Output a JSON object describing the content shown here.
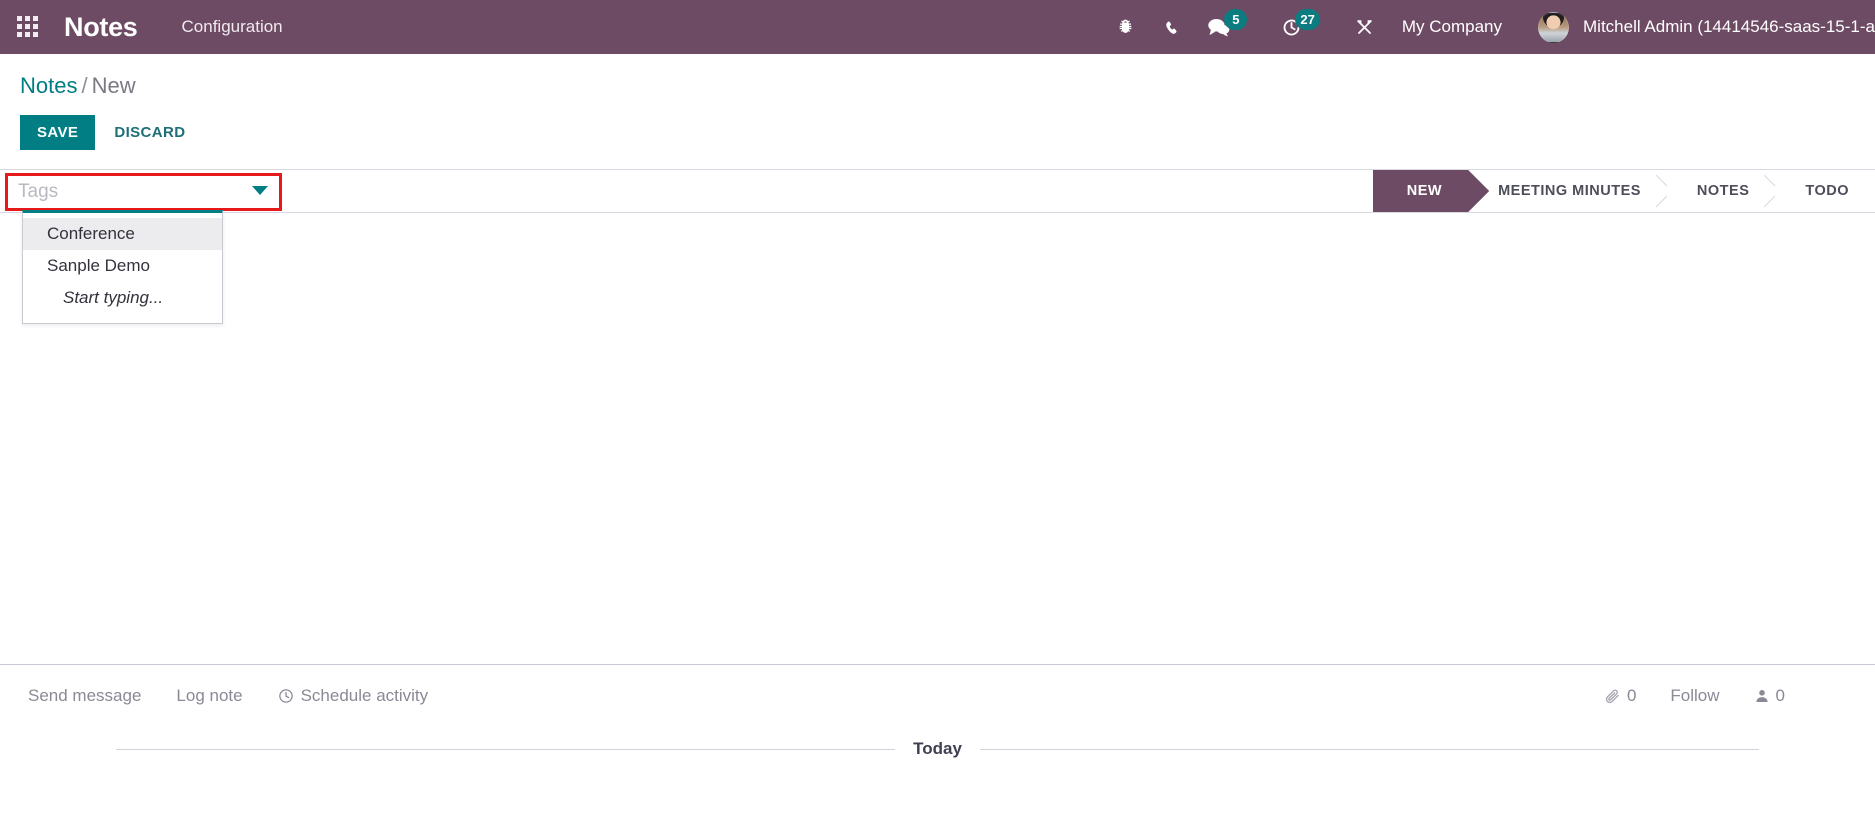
{
  "navbar": {
    "apps_icon": "apps-grid-icon",
    "brand": "Notes",
    "menu_item": "Configuration",
    "icons": [
      {
        "name": "bug-icon",
        "label": "Debug"
      },
      {
        "name": "phone-icon",
        "label": "VOIP"
      },
      {
        "name": "messages-icon",
        "label": "Messages",
        "badge": "5"
      },
      {
        "name": "activities-icon",
        "label": "Activities",
        "badge": "27"
      },
      {
        "name": "tools-icon",
        "label": "Developer Tools"
      }
    ],
    "company": "My Company",
    "user": "Mitchell Admin (14414546-saas-15-1-a",
    "avatar": "user-avatar",
    "bg_color": "#6E4B64"
  },
  "control_panel": {
    "breadcrumb_root": "Notes",
    "breadcrumb_separator": "/",
    "breadcrumb_current": "New",
    "save_label": "SAVE",
    "discard_label": "DISCARD",
    "accent_color": "#017E84"
  },
  "form": {
    "tags_field": {
      "placeholder": "Tags",
      "value": "",
      "highlight_color": "#E8191B",
      "caret_icon": "chevron-down-icon"
    },
    "tags_dropdown": {
      "options": [
        {
          "label": "Conference",
          "selected": true
        },
        {
          "label": "Sanple Demo",
          "selected": false
        }
      ],
      "hint": "Start typing..."
    },
    "statusbar": {
      "stages": [
        {
          "label": "NEW",
          "active": true
        },
        {
          "label": "MEETING MINUTES",
          "active": false
        },
        {
          "label": "NOTES",
          "active": false
        },
        {
          "label": "TODO",
          "active": false
        }
      ],
      "active_color": "#6E4B64"
    }
  },
  "chatter": {
    "send_message": "Send message",
    "log_note": "Log note",
    "schedule_activity": "Schedule activity",
    "schedule_icon": "clock-icon",
    "attachment_icon": "paperclip-icon",
    "attachment_count": "0",
    "follow_label": "Follow",
    "followers_icon": "user-icon",
    "followers_count": "0",
    "today_label": "Today"
  }
}
